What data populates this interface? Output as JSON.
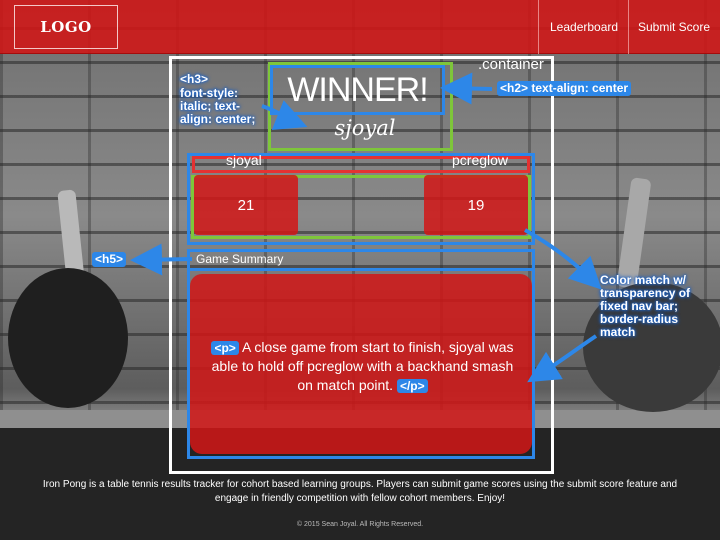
{
  "nav": {
    "logo": "LOGO",
    "links": [
      "Leaderboard",
      "Submit Score"
    ]
  },
  "container_label": ".container",
  "winner": {
    "heading": "WINNER!",
    "name": "sjoyal"
  },
  "scores": {
    "players": [
      {
        "name": "sjoyal",
        "score": "21"
      },
      {
        "name": "pcreglow",
        "score": "19"
      }
    ]
  },
  "summary": {
    "heading": "Game Summary",
    "text": "A close game from start to finish, sjoyal was able to hold off pcreglow with a backhand smash on match point."
  },
  "annotations": {
    "h3": "<h3>",
    "h3_style": "font-style: italic; text-align: center;",
    "h2": "<h2>",
    "h2_style": "text-align: center",
    "h5": "<h5>",
    "p_open": "<p>",
    "p_close": "</p>",
    "color_note": "Color match w/ transparency of fixed nav bar; border-radius match"
  },
  "footer": {
    "description": "Iron Pong is a table tennis results tracker for cohort based learning groups. Players can submit game scores using the submit score feature and engage in friendly competition with fellow cohort members. Enjoy!",
    "copyright": "© 2015 Sean Joyal. All Rights Reserved."
  },
  "colors": {
    "nav_red": "#d21616",
    "annotation_blue": "#2d87e8",
    "annotation_green": "#7ec63a",
    "annotation_red": "#e53232"
  }
}
